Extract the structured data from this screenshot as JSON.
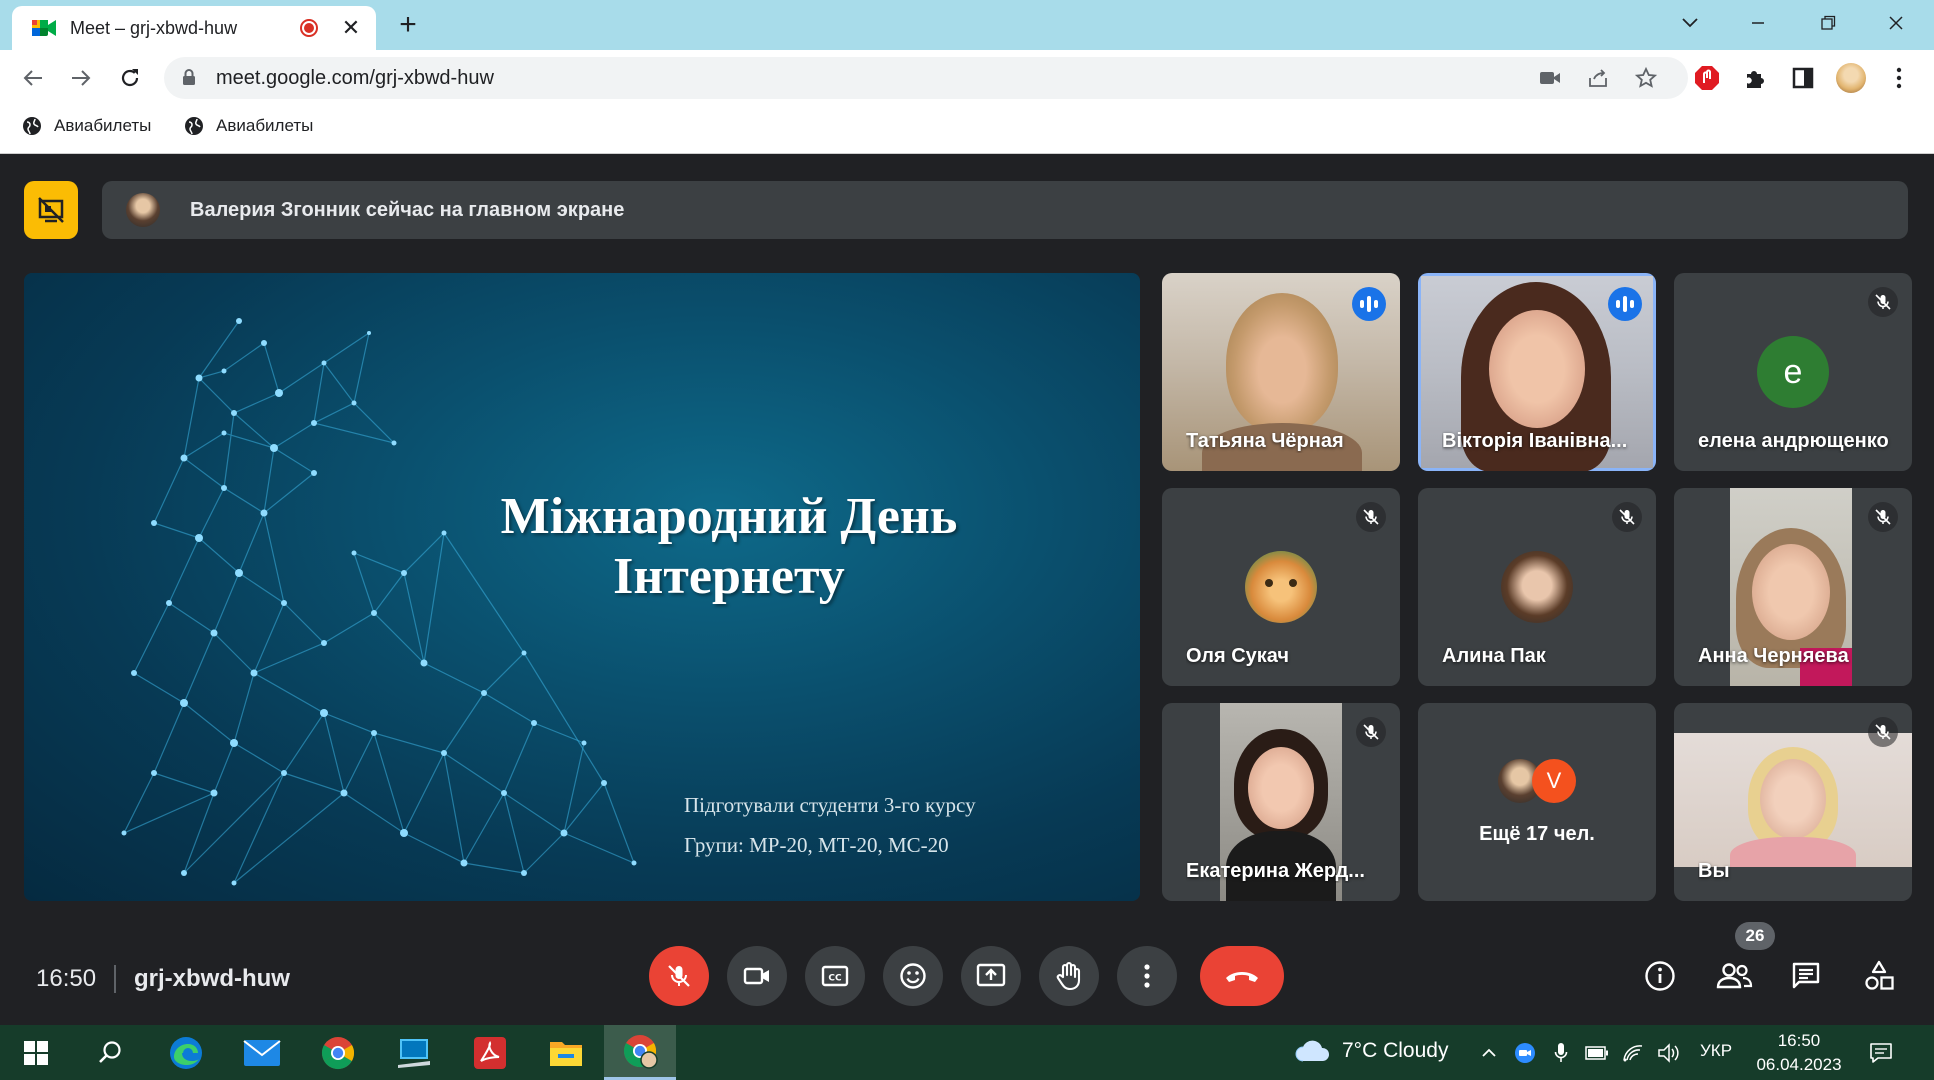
{
  "browser": {
    "tab_title": "Meet – grj-xbwd-huw",
    "tab_close": "✕",
    "new_tab": "+",
    "url": "meet.google.com/grj-xbwd-huw",
    "bookmarks": [
      {
        "label": "Авиабилеты"
      },
      {
        "label": "Авиабилеты"
      }
    ]
  },
  "meet": {
    "banner_text": "Валерия Згонник сейчас на главном экране",
    "slide": {
      "title_line1": "Міжнародний День",
      "title_line2": "Інтернету",
      "subtitle1": "Підготували студенти 3-го курсу",
      "subtitle2": "Групи: МР-20, МТ-20, МС-20"
    },
    "tiles": [
      {
        "name": "Татьяна Чёрная",
        "speaking": true
      },
      {
        "name": "Вікторія Іванівна...",
        "speaking": true,
        "active": true
      },
      {
        "name": "елена андрющенко",
        "avatar_letter": "е",
        "avatar_color": "#2e7d32"
      },
      {
        "name": "Оля Сукач"
      },
      {
        "name": "Алина Пак"
      },
      {
        "name": "Анна Черняева"
      },
      {
        "name": "Екатерина Жерд..."
      },
      {
        "name": "Ещё 17 чел.",
        "avatar_letter": "V",
        "avatar_color": "#f4511e"
      },
      {
        "name": "Вы"
      }
    ],
    "clock": "16:50",
    "meeting_code": "grj-xbwd-huw",
    "people_count": "26",
    "colors": {
      "accent": "#1a73e8",
      "danger": "#ea4335",
      "present": "#fbbc04"
    }
  },
  "taskbar": {
    "weather": "7°C  Cloudy",
    "lang": "УКР",
    "time": "16:50",
    "date": "06.04.2023"
  }
}
